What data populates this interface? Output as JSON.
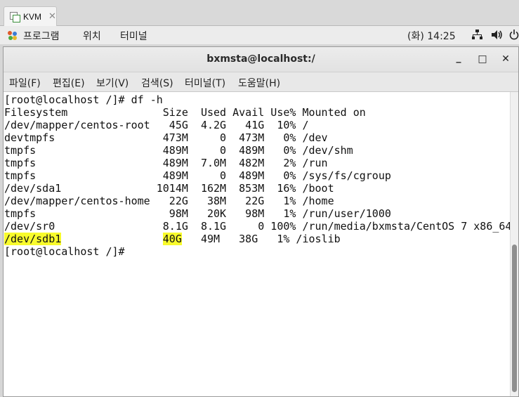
{
  "tab": {
    "title": "KVM",
    "close": "✕"
  },
  "topbar": {
    "apps": "프로그램",
    "places": "위치",
    "terminal": "터미널",
    "clock": "(화) 14:25",
    "network_icon": "network-icon",
    "volume_icon": "volume-icon",
    "power_icon": "power-icon"
  },
  "window": {
    "title": "bxmsta@localhost:/",
    "minimize": "_",
    "maximize": "□",
    "close": "✕"
  },
  "menubar": {
    "file": "파일(F)",
    "edit": "편집(E)",
    "view": "보기(V)",
    "search": "검색(S)",
    "terminal": "터미널(T)",
    "help": "도움말(H)"
  },
  "terminal": {
    "prompt1": "[root@localhost /]# df -h",
    "header": "Filesystem               Size  Used Avail Use% Mounted on",
    "rows": [
      "/dev/mapper/centos-root   45G  4.2G   41G  10% /",
      "devtmpfs                 473M     0  473M   0% /dev",
      "tmpfs                    489M     0  489M   0% /dev/shm",
      "tmpfs                    489M  7.0M  482M   2% /run",
      "tmpfs                    489M     0  489M   0% /sys/fs/cgroup",
      "/dev/sda1               1014M  162M  853M  16% /boot",
      "/dev/mapper/centos-home   22G   38M   22G   1% /home",
      "tmpfs                     98M   20K   98M   1% /run/user/1000",
      "/dev/sr0                 8.1G  8.1G     0 100% /run/media/bxmsta/CentOS 7 x86_64"
    ],
    "last_row": {
      "device": "/dev/sdb1",
      "pad1": "                ",
      "size": "40G",
      "rest": "   49M   38G   1% /ioslib"
    },
    "prompt2": "[root@localhost /]# "
  }
}
